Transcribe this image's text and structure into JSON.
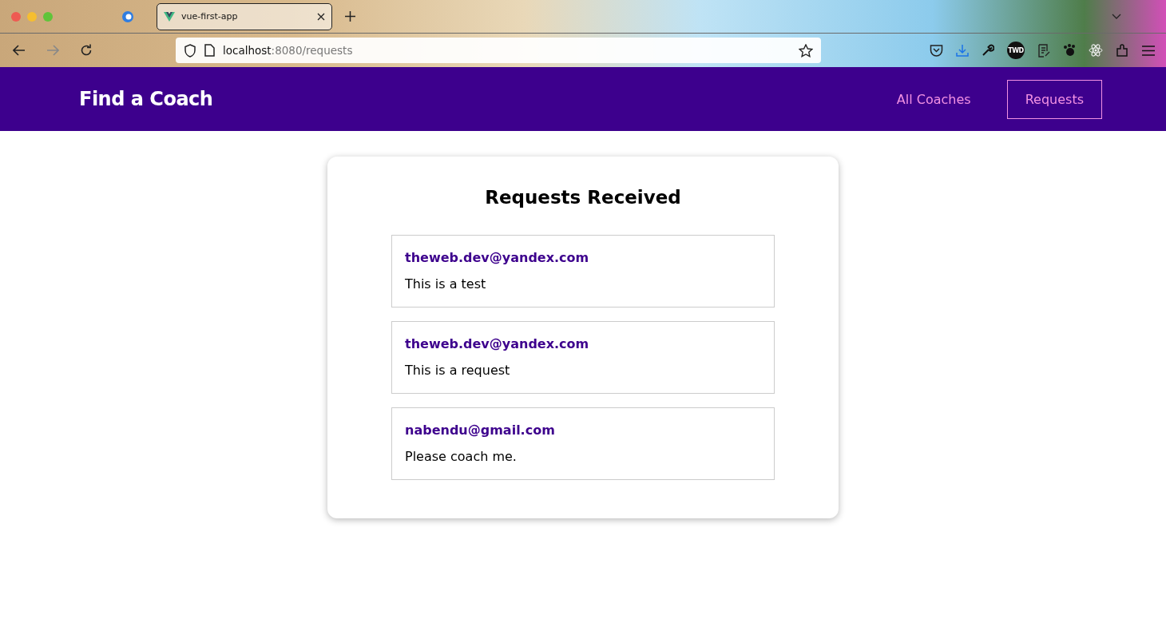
{
  "browser": {
    "tab_title": "vue-first-app",
    "address_host": "localhost",
    "address_path": ":8080/requests",
    "badge_text": "TWD"
  },
  "header": {
    "title": "Find a Coach",
    "nav": [
      {
        "label": "All Coaches",
        "selected": false
      },
      {
        "label": "Requests",
        "selected": true
      }
    ]
  },
  "page": {
    "heading": "Requests Received",
    "requests": [
      {
        "email": "theweb.dev@yandex.com",
        "message": "This is a test"
      },
      {
        "email": "theweb.dev@yandex.com",
        "message": "This is a request"
      },
      {
        "email": "nabendu@gmail.com",
        "message": "Please coach me."
      }
    ]
  }
}
